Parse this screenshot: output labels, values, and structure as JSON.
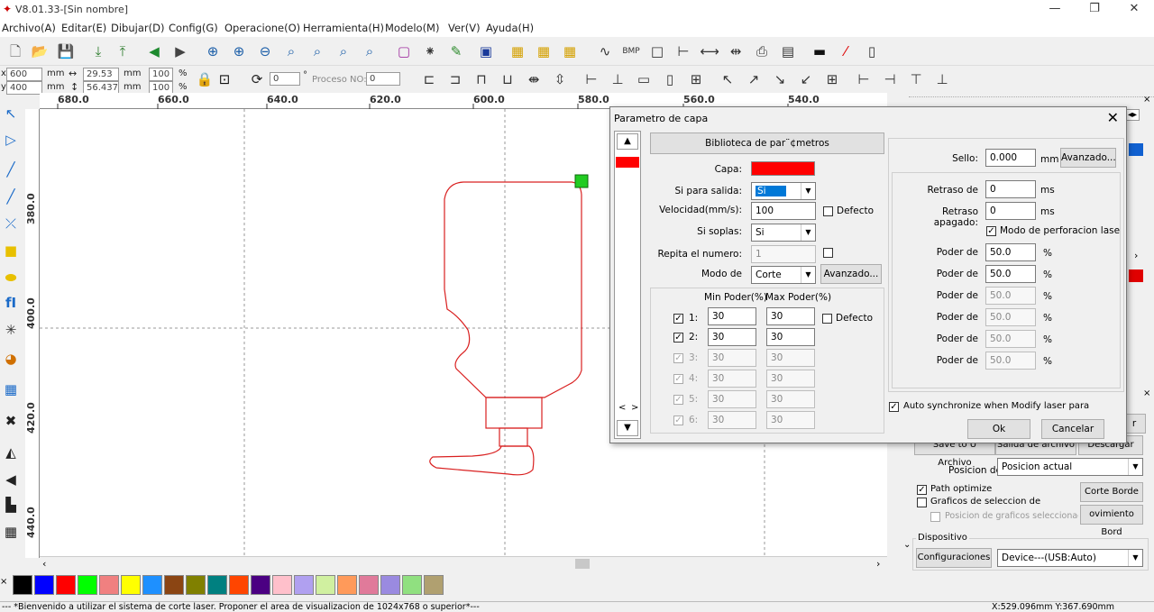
{
  "window": {
    "title": "V8.01.33-[Sin nombre]"
  },
  "menu": [
    "Archivo(A)",
    "Editar(E)",
    "Dibujar(D)",
    "Config(G)",
    "Operacione(O)",
    "Herramienta(H)",
    "Modelo(M)",
    "Ver(V)",
    "Ayuda(H)"
  ],
  "toolbar2": {
    "x_label": "x",
    "x_value": "600",
    "y_label": "y",
    "y_value": "400",
    "mm1": "mm",
    "mm2": "mm",
    "w_value": "29.53",
    "h_value": "56.437",
    "mm3": "mm",
    "mm4": "mm",
    "pct_w": "100",
    "pct_h": "100",
    "pct1": "%",
    "pct2": "%",
    "rotate_value": "0",
    "rotate_unit": "°",
    "proceso_label": "Proceso NO:",
    "proceso_value": "0"
  },
  "ruler_top": [
    "680.0",
    "660.0",
    "640.0",
    "620.0",
    "600.0",
    "580.0",
    "560.0",
    "540.0"
  ],
  "ruler_left": [
    "380.0",
    "400.0",
    "420.0",
    "440.0"
  ],
  "palette_colors": [
    "#000000",
    "#0000ff",
    "#ff0000",
    "#00ff00",
    "#f08080",
    "#ffff00",
    "#1e90ff",
    "#8b4513",
    "#808000",
    "#008080",
    "#ff4500",
    "#4b0082",
    "#ffc0cb",
    "#b0a0f0",
    "#d0f0a0",
    "#ff9a5a",
    "#e07a9a",
    "#9a8ae0",
    "#90e080",
    "#b0a070"
  ],
  "status": {
    "message": "--- *Bienvenido a utilizar el sistema de corte laser. Proponer el area de visualizacion de 1024x768 o superior*---",
    "coords": "X:529.096mm Y:367.690mm"
  },
  "dialog": {
    "title": "Parametro de capa",
    "library_button": "Biblioteca de par¨¢metros",
    "capa_label": "Capa:",
    "capa_color": "#ff0000",
    "salida_label": "Si para salida:",
    "salida_value": "Si",
    "velocidad_label": "Velocidad(mm/s):",
    "velocidad_value": "100",
    "defecto_label": "Defecto",
    "soplas_label": "Si soplas:",
    "soplas_value": "Si",
    "repita_label": "Repita el numero:",
    "repita_value": "1",
    "modo_label": "Modo de",
    "modo_value": "Corte",
    "avanzado_label": "Avanzado...",
    "min_poder_header": "Min Poder(%)",
    "max_poder_header": "Max Poder(%)",
    "defecto2_label": "Defecto",
    "power_rows": [
      {
        "num": "1:",
        "min": "30",
        "max": "30",
        "enabled": true
      },
      {
        "num": "2:",
        "min": "30",
        "max": "30",
        "enabled": true
      },
      {
        "num": "3:",
        "min": "30",
        "max": "30",
        "enabled": false
      },
      {
        "num": "4:",
        "min": "30",
        "max": "30",
        "enabled": false
      },
      {
        "num": "5:",
        "min": "30",
        "max": "30",
        "enabled": false
      },
      {
        "num": "6:",
        "min": "30",
        "max": "30",
        "enabled": false
      }
    ],
    "sello_label": "Sello:",
    "sello_value": "0.000",
    "sello_unit": "mm",
    "sello_avanzado": "Avanzado...",
    "retraso_de_label": "Retraso de",
    "retraso_de_value": "0",
    "retraso_apagado_label": "Retraso apagado:",
    "retraso_apagado_value": "0",
    "ms": "ms",
    "modo_perforacion_label": "Modo de perforacion lase",
    "poder_rows": [
      {
        "label": "Poder de",
        "value": "50.0",
        "enabled": true
      },
      {
        "label": "Poder de",
        "value": "50.0",
        "enabled": true
      },
      {
        "label": "Poder de",
        "value": "50.0",
        "enabled": false
      },
      {
        "label": "Poder de",
        "value": "50.0",
        "enabled": false
      },
      {
        "label": "Poder de",
        "value": "50.0",
        "enabled": false
      },
      {
        "label": "Poder de",
        "value": "50.0",
        "enabled": false
      }
    ],
    "pct": "%",
    "auto_sync_label": "Auto synchronize when Modify laser para",
    "ok_label": "Ok",
    "cancel_label": "Cancelar",
    "nav_left": "<",
    "nav_right": ">"
  },
  "right_panel": {
    "save_button": "Save to U Archivo",
    "salida_button": "Salida de archivo U",
    "descargar_button": "Descargar",
    "posicion_label": "Posicion de",
    "posicion_value": "Posicion actual",
    "path_optimize_label": "Path optimize",
    "graficos_label": "Graficos de seleccion de",
    "posicion_graficos_label": "Posicion de graficos seleccionado",
    "corte_borde_button": "Corte Borde",
    "movimiento_borde_button": "ovimiento Bord",
    "dispositivo_label": "Dispositivo",
    "configuraciones_button": "Configuraciones",
    "device_value": "Device---(USB:Auto)"
  }
}
